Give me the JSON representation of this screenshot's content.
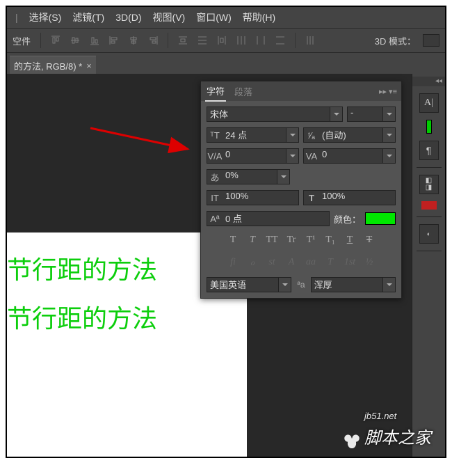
{
  "menu": {
    "items": [
      "选择(S)",
      "滤镜(T)",
      "3D(D)",
      "视图(V)",
      "窗口(W)",
      "帮助(H)"
    ]
  },
  "toolbar": {
    "label": "空件",
    "mode3d": "3D 模式："
  },
  "doc": {
    "tab": "的方法, RGB/8) *"
  },
  "canvas": {
    "line1": "节行距的方法",
    "line2": "节行距的方法"
  },
  "panel": {
    "tabs": {
      "char": "字符",
      "para": "段落"
    },
    "font": "宋体",
    "style": "-",
    "size": "24 点",
    "leading": "(自动)",
    "track": "0",
    "kern": "0",
    "pct": "0%",
    "hscale": "100%",
    "vscale": "100%",
    "baseline": "0 点",
    "colorLabel": "颜色：",
    "styleRow": [
      "T",
      "T",
      "TT",
      "Tr",
      "T¹",
      "T₁",
      "T",
      "Ŧ"
    ],
    "otRow": [
      "fi",
      "ℴ",
      "st",
      "A",
      "aa",
      "T",
      "1st",
      "½"
    ],
    "lang": "美国英语",
    "aa": "浑厚"
  },
  "watermark": {
    "site": "jb51.net",
    "name": "脚本之家"
  }
}
